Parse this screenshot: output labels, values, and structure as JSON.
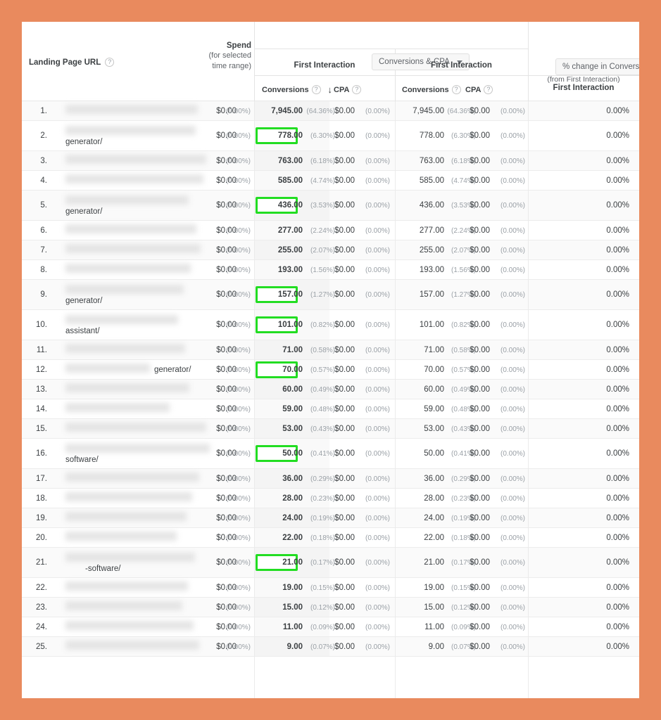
{
  "theme": {
    "frame_color": "#e98a5e",
    "highlight_color": "#22dd22",
    "panel_background": "#ffffff",
    "text_color": "#3c4043",
    "muted_text_color": "#9aa0a6"
  },
  "header": {
    "url_column_label": "Landing Page URL",
    "url_help_icon": "help-icon",
    "spend_label": "Spend",
    "spend_sub_line1": "(for selected",
    "spend_sub_line2": "time range)",
    "metric_dropdown_label": "Conversions & CPA",
    "metric_dropdown_caret": "chevron-down-icon",
    "change_dropdown_label": "% change in Conversions",
    "change_dropdown_caret": "chevron-down-icon",
    "change_dropdown_sub": "(from First Interaction)",
    "group1_label": "First Interaction",
    "group2_label": "First Interaction",
    "change_group_label": "First Interaction",
    "sub_conversions_1": "Conversions",
    "sub_cpa_1": "CPA",
    "sub_conversions_2": "Conversions",
    "sub_cpa_2": "CPA",
    "sort_arrow_icon": "arrow-down-icon",
    "sort_arrow_glyph": "↓",
    "help_glyph": "?"
  },
  "rows": [
    {
      "index": "1.",
      "url_suffix": "",
      "blur_width": 188,
      "blur2_width": 0,
      "blur2_left": 0,
      "spend": "$0.00",
      "spend_pct": "(0.00%)",
      "conv1": "7,945.00",
      "conv1_pct": "(64.36%)",
      "cpa1": "$0.00",
      "cpa1_pct": "(0.00%)",
      "conv2": "7,945.00",
      "conv2_pct": "(64.36%)",
      "cpa2": "$0.00",
      "cpa2_pct": "(0.00%)",
      "change": "0.00%",
      "highlighted": false,
      "tall": false
    },
    {
      "index": "2.",
      "url_suffix": "generator/",
      "blur_width": 185,
      "blur2_width": 0,
      "blur2_left": 0,
      "spend": "$0.00",
      "spend_pct": "(0.00%)",
      "conv1": "778.00",
      "conv1_pct": "(6.30%)",
      "cpa1": "$0.00",
      "cpa1_pct": "(0.00%)",
      "conv2": "778.00",
      "conv2_pct": "(6.30%)",
      "cpa2": "$0.00",
      "cpa2_pct": "(0.00%)",
      "change": "0.00%",
      "highlighted": true,
      "tall": true
    },
    {
      "index": "3.",
      "url_suffix": "",
      "blur_width": 200,
      "blur2_width": 0,
      "blur2_left": 0,
      "spend": "$0.00",
      "spend_pct": "(0.00%)",
      "conv1": "763.00",
      "conv1_pct": "(6.18%)",
      "cpa1": "$0.00",
      "cpa1_pct": "(0.00%)",
      "conv2": "763.00",
      "conv2_pct": "(6.18%)",
      "cpa2": "$0.00",
      "cpa2_pct": "(0.00%)",
      "change": "0.00%",
      "highlighted": false,
      "tall": false
    },
    {
      "index": "4.",
      "url_suffix": "",
      "blur_width": 196,
      "blur2_width": 0,
      "blur2_left": 0,
      "spend": "$0.00",
      "spend_pct": "(0.00%)",
      "conv1": "585.00",
      "conv1_pct": "(4.74%)",
      "cpa1": "$0.00",
      "cpa1_pct": "(0.00%)",
      "conv2": "585.00",
      "conv2_pct": "(4.74%)",
      "cpa2": "$0.00",
      "cpa2_pct": "(0.00%)",
      "change": "0.00%",
      "highlighted": false,
      "tall": false
    },
    {
      "index": "5.",
      "url_suffix": "generator/",
      "blur_width": 175,
      "blur2_width": 0,
      "blur2_left": 0,
      "spend": "$0.00",
      "spend_pct": "(0.00%)",
      "conv1": "436.00",
      "conv1_pct": "(3.53%)",
      "cpa1": "$0.00",
      "cpa1_pct": "(0.00%)",
      "conv2": "436.00",
      "conv2_pct": "(3.53%)",
      "cpa2": "$0.00",
      "cpa2_pct": "(0.00%)",
      "change": "0.00%",
      "highlighted": true,
      "tall": true
    },
    {
      "index": "6.",
      "url_suffix": "",
      "blur_width": 186,
      "blur2_width": 0,
      "blur2_left": 0,
      "spend": "$0.00",
      "spend_pct": "(0.00%)",
      "conv1": "277.00",
      "conv1_pct": "(2.24%)",
      "cpa1": "$0.00",
      "cpa1_pct": "(0.00%)",
      "conv2": "277.00",
      "conv2_pct": "(2.24%)",
      "cpa2": "$0.00",
      "cpa2_pct": "(0.00%)",
      "change": "0.00%",
      "highlighted": false,
      "tall": false
    },
    {
      "index": "7.",
      "url_suffix": "",
      "blur_width": 192,
      "blur2_width": 0,
      "blur2_left": 0,
      "spend": "$0.00",
      "spend_pct": "(0.00%)",
      "conv1": "255.00",
      "conv1_pct": "(2.07%)",
      "cpa1": "$0.00",
      "cpa1_pct": "(0.00%)",
      "conv2": "255.00",
      "conv2_pct": "(2.07%)",
      "cpa2": "$0.00",
      "cpa2_pct": "(0.00%)",
      "change": "0.00%",
      "highlighted": false,
      "tall": false
    },
    {
      "index": "8.",
      "url_suffix": "",
      "blur_width": 178,
      "blur2_width": 0,
      "blur2_left": 0,
      "spend": "$0.00",
      "spend_pct": "(0.00%)",
      "conv1": "193.00",
      "conv1_pct": "(1.56%)",
      "cpa1": "$0.00",
      "cpa1_pct": "(0.00%)",
      "conv2": "193.00",
      "conv2_pct": "(1.56%)",
      "cpa2": "$0.00",
      "cpa2_pct": "(0.00%)",
      "change": "0.00%",
      "highlighted": false,
      "tall": false
    },
    {
      "index": "9.",
      "url_suffix": "generator/",
      "blur_width": 168,
      "blur2_width": 0,
      "blur2_left": 0,
      "spend": "$0.00",
      "spend_pct": "(0.00%)",
      "conv1": "157.00",
      "conv1_pct": "(1.27%)",
      "cpa1": "$0.00",
      "cpa1_pct": "(0.00%)",
      "conv2": "157.00",
      "conv2_pct": "(1.27%)",
      "cpa2": "$0.00",
      "cpa2_pct": "(0.00%)",
      "change": "0.00%",
      "highlighted": true,
      "tall": true
    },
    {
      "index": "10.",
      "url_suffix": "assistant/",
      "blur_width": 160,
      "blur2_width": 0,
      "blur2_left": 0,
      "spend": "$0.00",
      "spend_pct": "(0.00%)",
      "conv1": "101.00",
      "conv1_pct": "(0.82%)",
      "cpa1": "$0.00",
      "cpa1_pct": "(0.00%)",
      "conv2": "101.00",
      "conv2_pct": "(0.82%)",
      "cpa2": "$0.00",
      "cpa2_pct": "(0.00%)",
      "change": "0.00%",
      "highlighted": true,
      "tall": true
    },
    {
      "index": "11.",
      "url_suffix": "",
      "blur_width": 170,
      "blur2_width": 0,
      "blur2_left": 0,
      "spend": "$0.00",
      "spend_pct": "(0.00%)",
      "conv1": "71.00",
      "conv1_pct": "(0.58%)",
      "cpa1": "$0.00",
      "cpa1_pct": "(0.00%)",
      "conv2": "71.00",
      "conv2_pct": "(0.58%)",
      "cpa2": "$0.00",
      "cpa2_pct": "(0.00%)",
      "change": "0.00%",
      "highlighted": false,
      "tall": false
    },
    {
      "index": "12.",
      "url_suffix": "generator/",
      "blur_width": 120,
      "blur2_width": 0,
      "blur2_left": 0,
      "spend": "$0.00",
      "spend_pct": "(0.00%)",
      "conv1": "70.00",
      "conv1_pct": "(0.57%)",
      "cpa1": "$0.00",
      "cpa1_pct": "(0.00%)",
      "conv2": "70.00",
      "conv2_pct": "(0.57%)",
      "cpa2": "$0.00",
      "cpa2_pct": "(0.00%)",
      "change": "0.00%",
      "highlighted": true,
      "tall": false,
      "suffix_inline": true
    },
    {
      "index": "13.",
      "url_suffix": "",
      "blur_width": 176,
      "blur2_width": 0,
      "blur2_left": 0,
      "spend": "$0.00",
      "spend_pct": "(0.00%)",
      "conv1": "60.00",
      "conv1_pct": "(0.49%)",
      "cpa1": "$0.00",
      "cpa1_pct": "(0.00%)",
      "conv2": "60.00",
      "conv2_pct": "(0.49%)",
      "cpa2": "$0.00",
      "cpa2_pct": "(0.00%)",
      "change": "0.00%",
      "highlighted": false,
      "tall": false
    },
    {
      "index": "14.",
      "url_suffix": "",
      "blur_width": 148,
      "blur2_width": 0,
      "blur2_left": 0,
      "spend": "$0.00",
      "spend_pct": "(0.00%)",
      "conv1": "59.00",
      "conv1_pct": "(0.48%)",
      "cpa1": "$0.00",
      "cpa1_pct": "(0.00%)",
      "conv2": "59.00",
      "conv2_pct": "(0.48%)",
      "cpa2": "$0.00",
      "cpa2_pct": "(0.00%)",
      "change": "0.00%",
      "highlighted": false,
      "tall": false
    },
    {
      "index": "15.",
      "url_suffix": "",
      "blur_width": 200,
      "blur2_width": 0,
      "blur2_left": 0,
      "spend": "$0.00",
      "spend_pct": "(0.00%)",
      "conv1": "53.00",
      "conv1_pct": "(0.43%)",
      "cpa1": "$0.00",
      "cpa1_pct": "(0.00%)",
      "conv2": "53.00",
      "conv2_pct": "(0.43%)",
      "cpa2": "$0.00",
      "cpa2_pct": "(0.00%)",
      "change": "0.00%",
      "highlighted": false,
      "tall": false
    },
    {
      "index": "16.",
      "url_suffix": "software/",
      "blur_width": 205,
      "blur2_width": 0,
      "blur2_left": 0,
      "spend": "$0.00",
      "spend_pct": "(0.00%)",
      "conv1": "50.00",
      "conv1_pct": "(0.41%)",
      "cpa1": "$0.00",
      "cpa1_pct": "(0.00%)",
      "conv2": "50.00",
      "conv2_pct": "(0.41%)",
      "cpa2": "$0.00",
      "cpa2_pct": "(0.00%)",
      "change": "0.00%",
      "highlighted": true,
      "tall": true
    },
    {
      "index": "17.",
      "url_suffix": "",
      "blur_width": 190,
      "blur2_width": 0,
      "blur2_left": 0,
      "spend": "$0.00",
      "spend_pct": "(0.00%)",
      "conv1": "36.00",
      "conv1_pct": "(0.29%)",
      "cpa1": "$0.00",
      "cpa1_pct": "(0.00%)",
      "conv2": "36.00",
      "conv2_pct": "(0.29%)",
      "cpa2": "$0.00",
      "cpa2_pct": "(0.00%)",
      "change": "0.00%",
      "highlighted": false,
      "tall": false
    },
    {
      "index": "18.",
      "url_suffix": "",
      "blur_width": 180,
      "blur2_width": 0,
      "blur2_left": 0,
      "spend": "$0.00",
      "spend_pct": "(0.00%)",
      "conv1": "28.00",
      "conv1_pct": "(0.23%)",
      "cpa1": "$0.00",
      "cpa1_pct": "(0.00%)",
      "conv2": "28.00",
      "conv2_pct": "(0.23%)",
      "cpa2": "$0.00",
      "cpa2_pct": "(0.00%)",
      "change": "0.00%",
      "highlighted": false,
      "tall": false
    },
    {
      "index": "19.",
      "url_suffix": "",
      "blur_width": 172,
      "blur2_width": 0,
      "blur2_left": 0,
      "spend": "$0.00",
      "spend_pct": "(0.00%)",
      "conv1": "24.00",
      "conv1_pct": "(0.19%)",
      "cpa1": "$0.00",
      "cpa1_pct": "(0.00%)",
      "conv2": "24.00",
      "conv2_pct": "(0.19%)",
      "cpa2": "$0.00",
      "cpa2_pct": "(0.00%)",
      "change": "0.00%",
      "highlighted": false,
      "tall": false
    },
    {
      "index": "20.",
      "url_suffix": "",
      "blur_width": 158,
      "blur2_width": 0,
      "blur2_left": 0,
      "spend": "$0.00",
      "spend_pct": "(0.00%)",
      "conv1": "22.00",
      "conv1_pct": "(0.18%)",
      "cpa1": "$0.00",
      "cpa1_pct": "(0.00%)",
      "conv2": "22.00",
      "conv2_pct": "(0.18%)",
      "cpa2": "$0.00",
      "cpa2_pct": "(0.00%)",
      "change": "0.00%",
      "highlighted": false,
      "tall": false
    },
    {
      "index": "21.",
      "url_suffix": "-software/",
      "blur_width": 184,
      "blur2_width": 0,
      "blur2_left": 0,
      "spend": "$0.00",
      "spend_pct": "(0.00%)",
      "conv1": "21.00",
      "conv1_pct": "(0.17%)",
      "cpa1": "$0.00",
      "cpa1_pct": "(0.00%)",
      "conv2": "21.00",
      "conv2_pct": "(0.17%)",
      "cpa2": "$0.00",
      "cpa2_pct": "(0.00%)",
      "change": "0.00%",
      "highlighted": true,
      "tall": true,
      "suffix_indent": 28
    },
    {
      "index": "22.",
      "url_suffix": "",
      "blur_width": 174,
      "blur2_width": 0,
      "blur2_left": 0,
      "spend": "$0.00",
      "spend_pct": "(0.00%)",
      "conv1": "19.00",
      "conv1_pct": "(0.15%)",
      "cpa1": "$0.00",
      "cpa1_pct": "(0.00%)",
      "conv2": "19.00",
      "conv2_pct": "(0.15%)",
      "cpa2": "$0.00",
      "cpa2_pct": "(0.00%)",
      "change": "0.00%",
      "highlighted": false,
      "tall": false
    },
    {
      "index": "23.",
      "url_suffix": "",
      "blur_width": 166,
      "blur2_width": 0,
      "blur2_left": 0,
      "spend": "$0.00",
      "spend_pct": "(0.00%)",
      "conv1": "15.00",
      "conv1_pct": "(0.12%)",
      "cpa1": "$0.00",
      "cpa1_pct": "(0.00%)",
      "conv2": "15.00",
      "conv2_pct": "(0.12%)",
      "cpa2": "$0.00",
      "cpa2_pct": "(0.00%)",
      "change": "0.00%",
      "highlighted": false,
      "tall": false
    },
    {
      "index": "24.",
      "url_suffix": "",
      "blur_width": 182,
      "blur2_width": 0,
      "blur2_left": 0,
      "spend": "$0.00",
      "spend_pct": "(0.00%)",
      "conv1": "11.00",
      "conv1_pct": "(0.09%)",
      "cpa1": "$0.00",
      "cpa1_pct": "(0.00%)",
      "conv2": "11.00",
      "conv2_pct": "(0.09%)",
      "cpa2": "$0.00",
      "cpa2_pct": "(0.00%)",
      "change": "0.00%",
      "highlighted": false,
      "tall": false
    },
    {
      "index": "25.",
      "url_suffix": "",
      "blur_width": 190,
      "blur2_width": 0,
      "blur2_left": 0,
      "spend": "$0.00",
      "spend_pct": "(0.00%)",
      "conv1": "9.00",
      "conv1_pct": "(0.07%)",
      "cpa1": "$0.00",
      "cpa1_pct": "(0.00%)",
      "conv2": "9.00",
      "conv2_pct": "(0.07%)",
      "cpa2": "$0.00",
      "cpa2_pct": "(0.00%)",
      "change": "0.00%",
      "highlighted": false,
      "tall": false
    }
  ]
}
